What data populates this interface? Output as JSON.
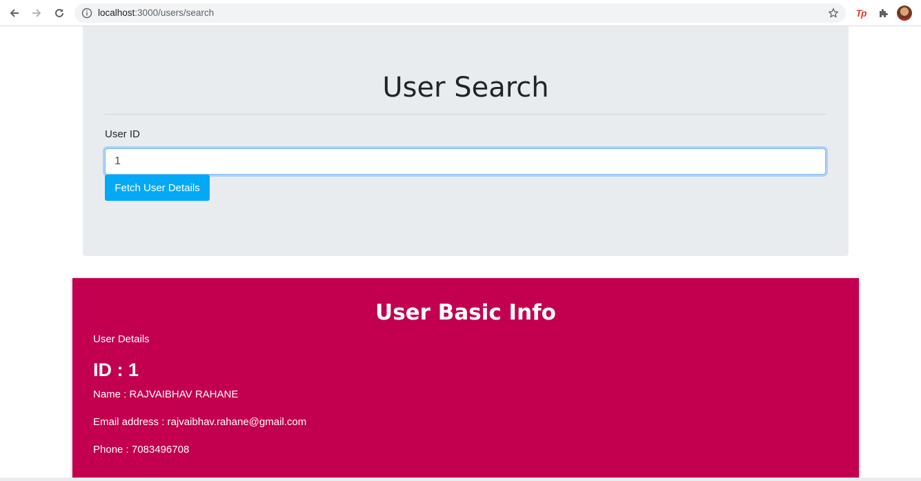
{
  "browser": {
    "url_host": "localhost",
    "url_path": ":3000/users/search",
    "extension_label": "Tp"
  },
  "search": {
    "title": "User Search",
    "field_label": "User ID",
    "input_value": "1",
    "button_label": "Fetch User Details"
  },
  "info": {
    "title": "User Basic Info",
    "subtitle": "User Details",
    "id_line": "ID : 1",
    "name_line": "Name : RAJVAIBHAV RAHANE",
    "email_line": "Email address : rajvaibhav.rahane@gmail.com",
    "phone_line": "Phone : 7083496708"
  },
  "colors": {
    "search_card_bg": "#e9ecef",
    "button_bg": "#03a9f4",
    "info_card_bg": "#c2004f"
  }
}
